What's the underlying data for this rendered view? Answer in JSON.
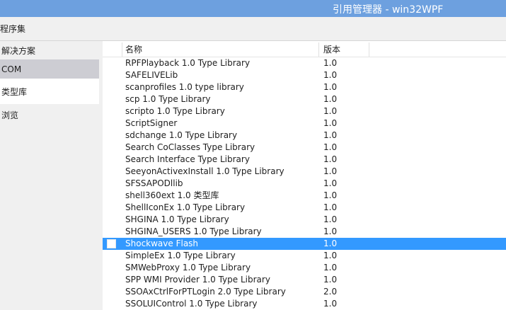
{
  "window": {
    "title": "引用管理器 - win32WPF"
  },
  "menubar": {
    "crumb": "程序集"
  },
  "sidebar": {
    "items": [
      {
        "label": "解决方案"
      },
      {
        "label": "COM"
      },
      {
        "label": "类型库"
      },
      {
        "label": "浏览"
      }
    ]
  },
  "list": {
    "columns": {
      "name": "名称",
      "version": "版本"
    },
    "selected_index": 15,
    "rows": [
      {
        "name": "RPFPlayback 1.0 Type Library",
        "version": "1.0"
      },
      {
        "name": "SAFELIVELib",
        "version": "1.0"
      },
      {
        "name": "scanprofiles 1.0 type library",
        "version": "1.0"
      },
      {
        "name": "scp 1.0 Type Library",
        "version": "1.0"
      },
      {
        "name": "scripto 1.0 Type Library",
        "version": "1.0"
      },
      {
        "name": "ScriptSigner",
        "version": "1.0"
      },
      {
        "name": "sdchange 1.0 Type Library",
        "version": "1.0"
      },
      {
        "name": "Search CoClasses Type Library",
        "version": "1.0"
      },
      {
        "name": "Search Interface Type Library",
        "version": "1.0"
      },
      {
        "name": "SeeyonActivexInstall 1.0 Type Library",
        "version": "1.0"
      },
      {
        "name": "SFSSAPODllib",
        "version": "1.0"
      },
      {
        "name": "shell360ext 1.0 类型库",
        "version": "1.0"
      },
      {
        "name": "ShellIconEx 1.0 Type Library",
        "version": "1.0"
      },
      {
        "name": "SHGINA 1.0 Type Library",
        "version": "1.0"
      },
      {
        "name": "SHGINA_USERS 1.0 Type Library",
        "version": "1.0"
      },
      {
        "name": "Shockwave Flash",
        "version": "1.0"
      },
      {
        "name": "SimpleEx 1.0 Type Library",
        "version": "1.0"
      },
      {
        "name": "SMWebProxy 1.0 Type Library",
        "version": "1.0"
      },
      {
        "name": "SPP WMI Provider 1.0 Type Library",
        "version": "1.0"
      },
      {
        "name": "SSOAxCtrlForPTLogin 2.0 Type Library",
        "version": "2.0"
      },
      {
        "name": "SSOLUIControl 1.0 Type Library",
        "version": "1.0"
      }
    ]
  },
  "colors": {
    "titlebar": "#6da0df",
    "selection": "#3399ff",
    "sidebar_active": "#cdcdd3"
  }
}
